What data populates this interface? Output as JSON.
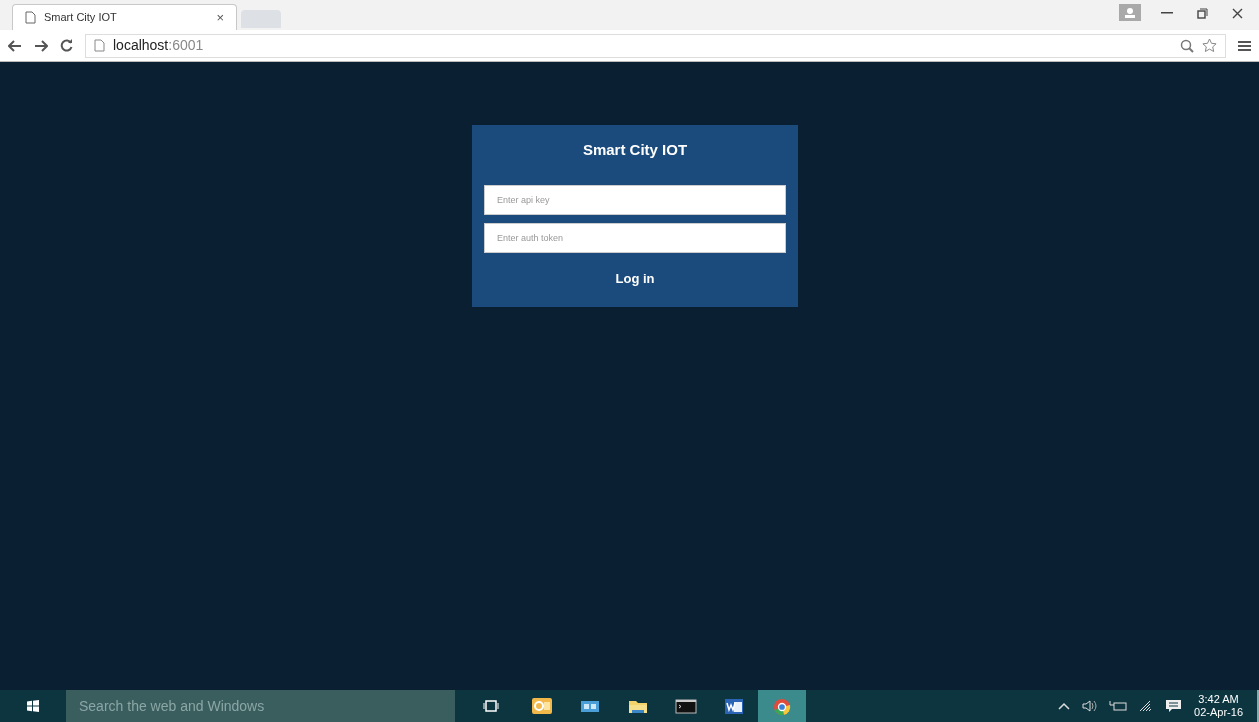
{
  "browser": {
    "tab_title": "Smart City IOT",
    "tab_close": "×",
    "url_host": "localhost",
    "url_port": ":6001"
  },
  "login": {
    "title": "Smart City IOT",
    "fields": [
      {
        "placeholder": "Enter api key"
      },
      {
        "placeholder": "Enter auth token"
      }
    ],
    "button": "Log in"
  },
  "taskbar": {
    "search_placeholder": "Search the web and Windows",
    "apps": [
      {
        "kind": "outlook",
        "selected": false
      },
      {
        "kind": "store",
        "selected": false
      },
      {
        "kind": "folder",
        "selected": false
      },
      {
        "kind": "terminal",
        "selected": false
      },
      {
        "kind": "word",
        "selected": false
      },
      {
        "kind": "chrome",
        "selected": true
      }
    ],
    "time": "3:42 AM",
    "date": "02-Apr-16"
  }
}
